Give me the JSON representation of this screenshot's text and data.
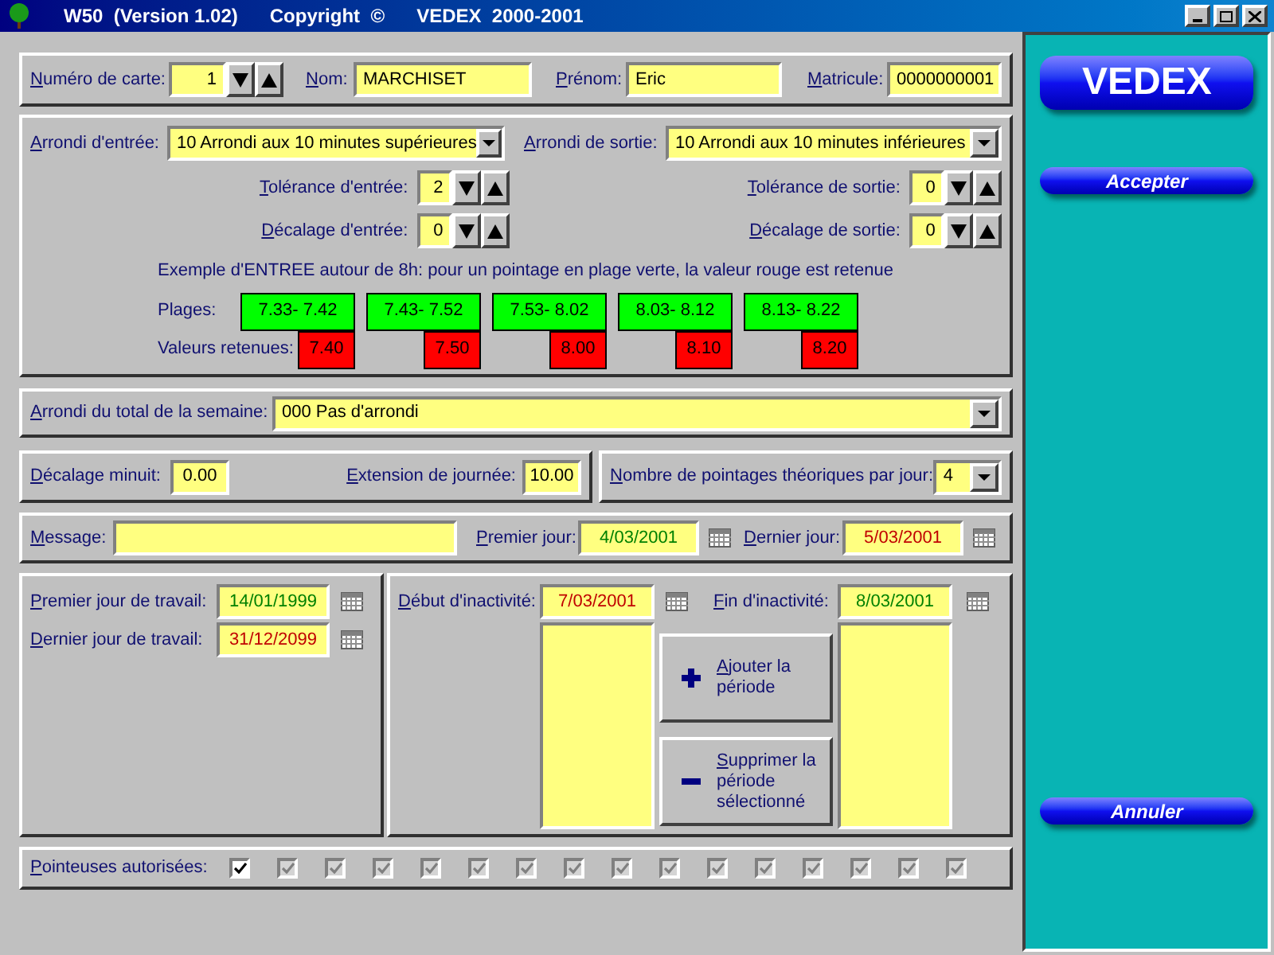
{
  "window": {
    "title_parts": [
      "W50  (Version 1.02)",
      "Copyright  ©",
      "VEDEX  2000-2001"
    ]
  },
  "card": {
    "card_number": {
      "label": "Numéro de carte:",
      "value": "1"
    },
    "last_name": {
      "label": "Nom:",
      "value": "MARCHISET"
    },
    "first_name": {
      "label": "Prénom:",
      "value": "Eric"
    },
    "employee_id": {
      "label": "Matricule:",
      "value": "0000000001"
    }
  },
  "rounding": {
    "entry": {
      "label": "Arrondi d'entrée:",
      "value": "10 Arrondi aux 10 minutes supérieures"
    },
    "exit": {
      "label": "Arrondi de sortie:",
      "value": "10 Arrondi aux 10 minutes inférieures"
    },
    "entry_tolerance": {
      "label": "Tolérance d'entrée:",
      "value": "2"
    },
    "exit_tolerance": {
      "label": "Tolérance de sortie:",
      "value": "0"
    },
    "entry_offset": {
      "label": "Décalage d'entrée:",
      "value": "0"
    },
    "exit_offset": {
      "label": "Décalage de sortie:",
      "value": "0"
    },
    "example": "Exemple d'ENTREE autour de 8h: pour un pointage en plage verte, la valeur rouge est retenue",
    "ranges_label": "Plages:",
    "values_label": "Valeurs retenues:",
    "slots": [
      {
        "range": "7.33- 7.42",
        "value": "7.40"
      },
      {
        "range": "7.43- 7.52",
        "value": "7.50"
      },
      {
        "range": "7.53- 8.02",
        "value": "8.00"
      },
      {
        "range": "8.03- 8.12",
        "value": "8.10"
      },
      {
        "range": "8.13- 8.22",
        "value": "8.20"
      }
    ]
  },
  "weekly_rounding": {
    "label": "Arrondi du total de la semaine:",
    "value": "000 Pas d'arrondi"
  },
  "midnight_offset": {
    "label": "Décalage minuit:",
    "value": "0.00"
  },
  "day_extension": {
    "label": "Extension de journée:",
    "value": "10.00"
  },
  "punches_per_day": {
    "label": "Nombre de pointages théoriques par jour:",
    "value": "4"
  },
  "message": {
    "label": "Message:"
  },
  "first_day": {
    "label": "Premier jour:",
    "value": "4/03/2001",
    "color": "#008000"
  },
  "last_day": {
    "label": "Dernier jour:",
    "value": "5/03/2001",
    "color": "#c00000"
  },
  "first_work_day": {
    "label": "Premier jour de travail:",
    "value": "14/01/1999",
    "color": "#008000"
  },
  "last_work_day": {
    "label": "Dernier jour de travail:",
    "value": "31/12/2099",
    "color": "#c00000"
  },
  "inactivity_start": {
    "label": "Début d'inactivité:",
    "value": "7/03/2001",
    "color": "#c00000"
  },
  "inactivity_end": {
    "label": "Fin d'inactivité:",
    "value": "8/03/2001",
    "color": "#008000"
  },
  "add_button": "Ajouter la période",
  "remove_button": "Supprimer la période sélectionné",
  "terminals": {
    "label": "Pointeuses autorisées:",
    "items": [
      {
        "checked": true,
        "disabled": false
      },
      {
        "checked": true,
        "disabled": true
      },
      {
        "checked": true,
        "disabled": true
      },
      {
        "checked": true,
        "disabled": true
      },
      {
        "checked": true,
        "disabled": true
      },
      {
        "checked": true,
        "disabled": true
      },
      {
        "checked": true,
        "disabled": true
      },
      {
        "checked": true,
        "disabled": true
      },
      {
        "checked": true,
        "disabled": true
      },
      {
        "checked": true,
        "disabled": true
      },
      {
        "checked": true,
        "disabled": true
      },
      {
        "checked": true,
        "disabled": true
      },
      {
        "checked": true,
        "disabled": true
      },
      {
        "checked": true,
        "disabled": true
      },
      {
        "checked": true,
        "disabled": true
      },
      {
        "checked": true,
        "disabled": true
      }
    ]
  },
  "side_panel": {
    "logo": "VEDEX",
    "accept": "Accepter",
    "cancel": "Annuler"
  }
}
